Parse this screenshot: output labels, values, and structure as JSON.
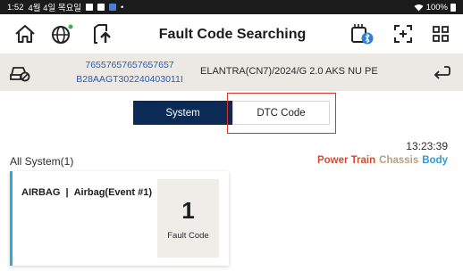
{
  "status_bar": {
    "time": "1:52",
    "date": "4월 4일 목요일",
    "battery": "100%"
  },
  "toolbar": {
    "title": "Fault Code Searching",
    "icons": [
      "home-icon",
      "globe-icon",
      "upload-icon",
      "bluetooth-device-icon",
      "expand-icon",
      "grid-icon"
    ]
  },
  "vehicle": {
    "vin_line1": "76557657657657657",
    "vin_line2": "B28AAGT302240403011I",
    "name": "ELANTRA(CN7)/2024/G 2.0 AKS NU PE"
  },
  "tabs": {
    "system_label": "System",
    "dtc_label": "DTC Code",
    "active": "System"
  },
  "summary": {
    "time": "13:23:39",
    "all_system_label": "All System(1)",
    "filters": {
      "powertrain": "Power Train",
      "chassis": "Chassis",
      "body": "Body"
    }
  },
  "cards": [
    {
      "system": "AIRBAG",
      "separator": "|",
      "event": "Airbag(Event #1)",
      "count": "1",
      "count_label": "Fault Code"
    }
  ],
  "colors": {
    "navy": "#0b2a55",
    "powertrain": "#d84a2a",
    "chassis": "#b8a07a",
    "body": "#2d9cd6",
    "card_accent": "#2fa8dc",
    "highlight": "#d9342b"
  }
}
